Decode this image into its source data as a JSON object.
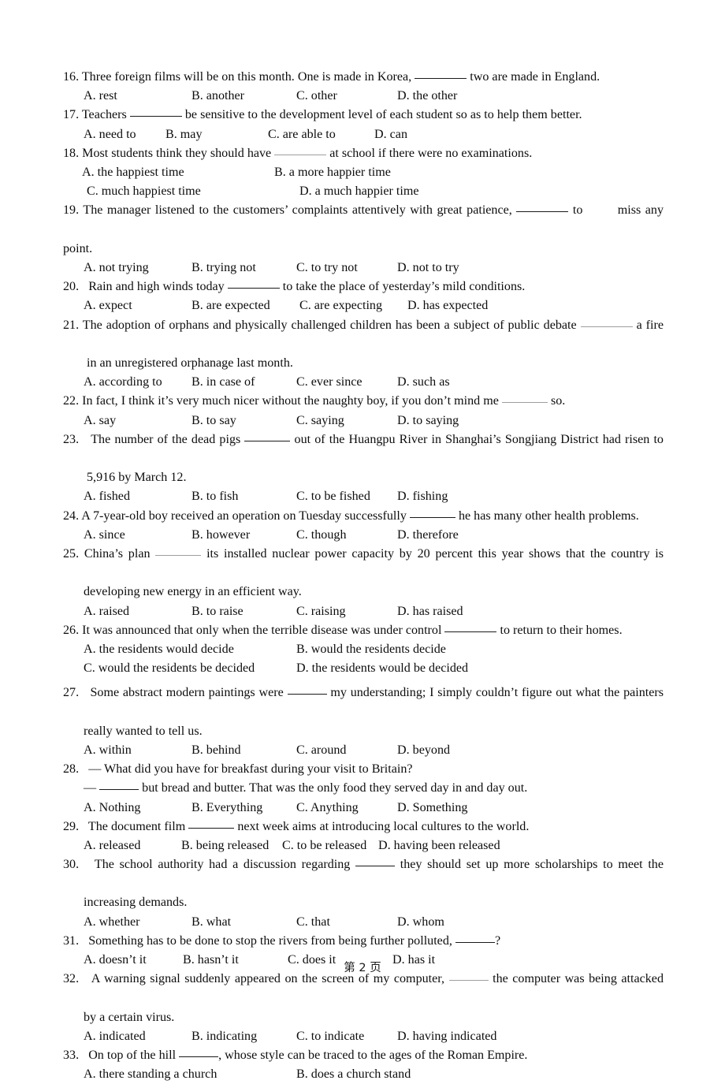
{
  "document": {
    "type": "exam-paper",
    "section": "multiple-choice-grammar",
    "footer": "第 2 页"
  },
  "questions": [
    {
      "number": "16.",
      "stem_lines": [
        {
          "segments": [
            "16. Three foreign films will be on this month. One is made in Korea, ",
            "BLANK",
            " two are made in England."
          ]
        }
      ],
      "stem": "Three foreign films will be on this month. One is made in Korea, ______ two are made in England.",
      "pre_blank": "16. Three foreign films will be on this month. One is made in Korea,",
      "post_blank": "two are made in England.",
      "blank_style": "solid",
      "blank_size": "b-lg",
      "options": [
        "A. rest",
        "B. another",
        "C. other",
        "D. the other"
      ],
      "layout": "four-column"
    },
    {
      "number": "17.",
      "pre_blank": "17. Teachers",
      "post_blank": "be sensitive to the development level of each student so as to help them better.",
      "blank_style": "solid",
      "blank_size": "b-lg",
      "options": [
        "A. need to",
        "B. may",
        "C. are able to",
        "D. can"
      ],
      "layout": "four-column",
      "option_stops": [
        110,
        215,
        345,
        475
      ]
    },
    {
      "number": "18.",
      "pre_blank": "18. Most students think they should have",
      "post_blank": "at school if there were no examinations.",
      "blank_style": "dotted",
      "blank_size": "b-lg",
      "options": [
        "A. the happiest time",
        "B. a more happier time",
        "C. much happiest time",
        "D. a much happier time"
      ],
      "layout": "two-column-offset"
    },
    {
      "number": "19.",
      "line1": "19. The manager listened to the customers’ complaints attentively with great patience,",
      "line1_after_blank": "to        miss any",
      "line2": "point.",
      "blank_style": "solid",
      "blank_size": "b-lg",
      "options": [
        "A. not trying",
        "B. trying not",
        "C. to try not",
        "D. not to try"
      ],
      "layout": "four-column"
    },
    {
      "number": "20.",
      "pre_blank": "20.   Rain and high winds today",
      "post_blank": "to take the place of yesterday’s mild conditions.",
      "blank_style": "solid",
      "blank_size": "b-lg",
      "options": [
        "A. expect",
        "B. are expected",
        "C. are expecting",
        "D. has expected"
      ],
      "layout": "four-column"
    },
    {
      "number": "21.",
      "line1": "21. The adoption of orphans and physically challenged children has been a subject of public debate",
      "line1_after_blank": "a fire",
      "line2": "in an unregistered orphanage last month.",
      "blank_style": "dotted",
      "blank_size": "b-lg",
      "options": [
        "A. according to",
        "B. in case of",
        "C. ever since",
        "D. such as"
      ],
      "layout": "four-column"
    },
    {
      "number": "22.",
      "pre_blank": "22. In fact, I think it’s very much nicer without the naughty boy, if you don’t mind me",
      "post_blank": "so.",
      "blank_style": "dotted",
      "blank_size": "b-md",
      "options": [
        "A. say",
        "B. to say",
        "C. saying",
        "D. to saying"
      ],
      "layout": "four-column"
    },
    {
      "number": "23.",
      "line1": "23.   The number of the dead pigs",
      "line1_after_blank": "out of the Huangpu River in Shanghai’s Songjiang District had risen to",
      "line2": "5,916 by March 12.",
      "blank_style": "solid",
      "blank_size": "b-md",
      "options": [
        "A. fished",
        "B. to fish",
        "C. to be fished",
        "D. fishing"
      ],
      "layout": "four-column"
    },
    {
      "number": "24.",
      "pre_blank": "24. A 7-year-old boy received an operation on Tuesday successfully",
      "post_blank": "he has many other health problems.",
      "blank_style": "solid",
      "blank_size": "b-md",
      "options": [
        "A. since",
        "B. however",
        "C. though",
        "D. therefore"
      ],
      "layout": "four-column"
    },
    {
      "number": "25.",
      "line1": "25. China’s plan",
      "line1_after_blank": "its installed nuclear power capacity by 20 percent this year shows that the country is",
      "line2": "developing new energy in an efficient way.",
      "blank_style": "dotted",
      "blank_size": "b-md",
      "options": [
        "A. raised",
        "B. to raise",
        "C. raising",
        "D. has raised"
      ],
      "layout": "four-column"
    },
    {
      "number": "26.",
      "pre_blank": "26. It was announced that only when the terrible disease was under control",
      "post_blank": "to return to their homes.",
      "blank_style": "solid",
      "blank_size": "b-lg",
      "options": [
        "A. the residents would decide",
        "B. would the residents decide",
        "C. would the residents be decided",
        "D. the residents would be decided"
      ],
      "layout": "two-column"
    },
    {
      "number": "27.",
      "line1": "27.   Some abstract modern paintings were",
      "line1_after_blank": "my understanding; I simply couldn’t figure out what the painters",
      "line2": "really wanted to tell us.",
      "blank_style": "solid",
      "blank_size": "b-sm",
      "options": [
        "A. within",
        "B. behind",
        "C. around",
        "D. beyond"
      ],
      "layout": "four-column"
    },
    {
      "number": "28.",
      "line1": "28.   — What did you have for breakfast during your visit to Britain?",
      "line2_pre": "—",
      "line2_post": "but bread and butter. That was the only food they served day in and day out.",
      "blank_style": "solid",
      "blank_size": "b-sm",
      "options": [
        "A. Nothing",
        "B. Everything",
        "C. Anything",
        "D. Something"
      ],
      "layout": "four-column"
    },
    {
      "number": "29.",
      "pre_blank": "29.   The document film",
      "post_blank": "next week aims at introducing local cultures to the world.",
      "blank_style": "solid",
      "blank_size": "b-md",
      "options": [
        "A. released",
        "B. being released",
        "C. to be released",
        "D. having been released"
      ],
      "layout": "four-column-wide"
    },
    {
      "number": "30.",
      "line1": "30.   The school authority had a discussion regarding",
      "line1_after_blank": "they should set up more scholarships to meet the",
      "line2": "increasing demands.",
      "blank_style": "solid",
      "blank_size": "b-sm",
      "options": [
        "A. whether",
        "B. what",
        "C. that",
        "D. whom"
      ],
      "layout": "four-column"
    },
    {
      "number": "31.",
      "pre_blank": "31.   Something has to be done to stop the rivers from being further polluted,",
      "post_blank": "?",
      "blank_style": "solid",
      "blank_size": "b-sm",
      "options": [
        "A. doesn’t it",
        "B. hasn’t it",
        "C. does it",
        "D. has it"
      ],
      "layout": "four-column"
    },
    {
      "number": "32.",
      "line1": "32.   A warning signal suddenly appeared on the screen of my computer,",
      "line1_after_blank": "the computer was being attacked",
      "line2": "by a certain virus.",
      "blank_style": "dotted",
      "blank_size": "b-sm",
      "options": [
        "A. indicated",
        "B. indicating",
        "C. to indicate",
        "D. having indicated"
      ],
      "layout": "four-column"
    },
    {
      "number": "33.",
      "pre_blank": "33.   On top of the hill",
      "post_blank": ", whose style can be traced to the ages of the Roman Empire.",
      "blank_style": "solid",
      "blank_size": "b-sm",
      "options": [
        "A. there standing a church",
        "B. does a church stand"
      ],
      "layout": "two-column"
    }
  ]
}
